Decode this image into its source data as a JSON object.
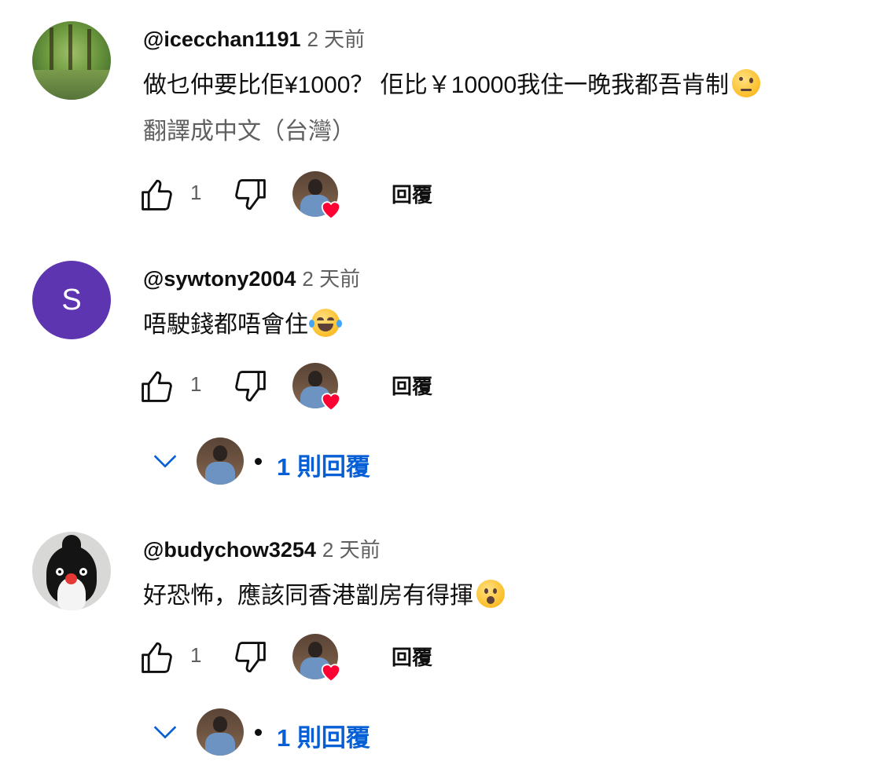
{
  "comments": [
    {
      "author": "@icecchan1191",
      "time": "2 天前",
      "text": "做乜仲要比佢¥1000？ 佢比￥10000我住一晚我都吾肯制",
      "emoji": "face-with-raised-eyebrow",
      "translate_label": "翻譯成中文（台灣）",
      "likes": "1",
      "reply_label": "回覆",
      "avatar": "forest-photo"
    },
    {
      "author": "@sywtony2004",
      "time": "2 天前",
      "text": "唔駛錢都唔會住",
      "emoji": "face-with-tears-of-joy",
      "likes": "1",
      "reply_label": "回覆",
      "avatar_letter": "S",
      "avatar_color": "#5e35b1",
      "replies_label": "1 則回覆"
    },
    {
      "author": "@budychow3254",
      "time": "2 天前",
      "text": "好恐怖，應該同香港劏房有得揮",
      "emoji": "face-with-open-mouth",
      "likes": "1",
      "reply_label": "回覆",
      "avatar": "penguin-plush",
      "replies_label": "1 則回覆"
    }
  ],
  "colors": {
    "link_blue": "#065fd4",
    "secondary_text": "#606060",
    "heart_red": "#ff0033"
  }
}
